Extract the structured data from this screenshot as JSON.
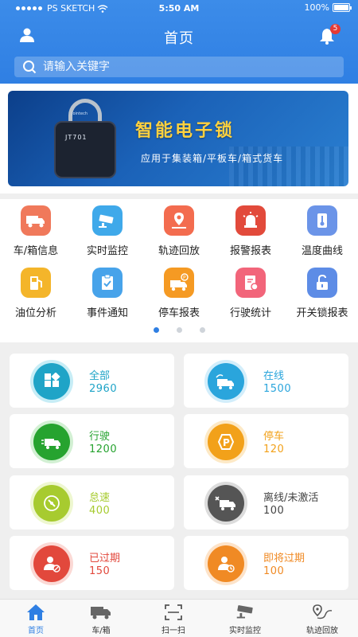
{
  "status_bar": {
    "carrier": "PS SKETCH",
    "time": "5:50 AM",
    "battery": "100%"
  },
  "header": {
    "title": "首页",
    "notification_count": "5"
  },
  "search": {
    "placeholder": "请输入关键字"
  },
  "banner": {
    "device_model": "JT701",
    "device_brand": "Jointech",
    "headline": "智能电子锁",
    "tagline": "应用于集装箱/平板车/箱式货车"
  },
  "menu": {
    "items": [
      {
        "label": "车/箱信息",
        "icon": "truck-icon",
        "color": "#f0795b"
      },
      {
        "label": "实时监控",
        "icon": "camera-icon",
        "color": "#3fa9ea"
      },
      {
        "label": "轨迹回放",
        "icon": "route-pin-icon",
        "color": "#f36c4f"
      },
      {
        "label": "报警报表",
        "icon": "alarm-light-icon",
        "color": "#e24a3b"
      },
      {
        "label": "温度曲线",
        "icon": "thermometer-icon",
        "color": "#6b94e8"
      },
      {
        "label": "油位分析",
        "icon": "fuel-pump-icon",
        "color": "#f4b52a"
      },
      {
        "label": "事件通知",
        "icon": "clipboard-check-icon",
        "color": "#47a3ea"
      },
      {
        "label": "停车报表",
        "icon": "parking-truck-icon",
        "color": "#f59a23"
      },
      {
        "label": "行驶统计",
        "icon": "report-chart-icon",
        "color": "#f2657a"
      },
      {
        "label": "开关锁报表",
        "icon": "unlock-icon",
        "color": "#5d8ce6"
      }
    ],
    "pages": 3,
    "active_page": 0
  },
  "stats": [
    {
      "label": "全部",
      "value": "2960",
      "icon": "grid-icon",
      "color": "#1fa4c7",
      "ring": "#c7edf6"
    },
    {
      "label": "在线",
      "value": "1500",
      "icon": "online-truck-icon",
      "color": "#2aa5dc",
      "ring": "#d3eefb"
    },
    {
      "label": "行驶",
      "value": "1200",
      "icon": "driving-truck-icon",
      "color": "#26a32f",
      "ring": "#d2f0d3"
    },
    {
      "label": "停车",
      "value": "120",
      "icon": "parking-icon",
      "color": "#f2a11a",
      "ring": "#fde9c6"
    },
    {
      "label": "怠速",
      "value": "400",
      "icon": "idle-icon",
      "color": "#a7cb2f",
      "ring": "#eef7d0"
    },
    {
      "label": "离线/未激活",
      "value": "100",
      "icon": "offline-truck-icon",
      "color": "#555555",
      "ring": "#dcdcdc"
    },
    {
      "label": "已过期",
      "value": "150",
      "icon": "expired-user-icon",
      "color": "#e2483c",
      "ring": "#fbd9d5"
    },
    {
      "label": "即将过期",
      "value": "100",
      "icon": "expiring-user-icon",
      "color": "#f08a24",
      "ring": "#fde3c9"
    }
  ],
  "tabbar": {
    "items": [
      {
        "label": "首页",
        "icon": "home-icon",
        "active": true
      },
      {
        "label": "车/箱",
        "icon": "truck-tab-icon",
        "active": false
      },
      {
        "label": "扫一扫",
        "icon": "scan-icon",
        "active": false
      },
      {
        "label": "实时监控",
        "icon": "camera-tab-icon",
        "active": false
      },
      {
        "label": "轨迹回放",
        "icon": "track-tab-icon",
        "active": false
      }
    ],
    "accent": "#2f7fe3"
  }
}
